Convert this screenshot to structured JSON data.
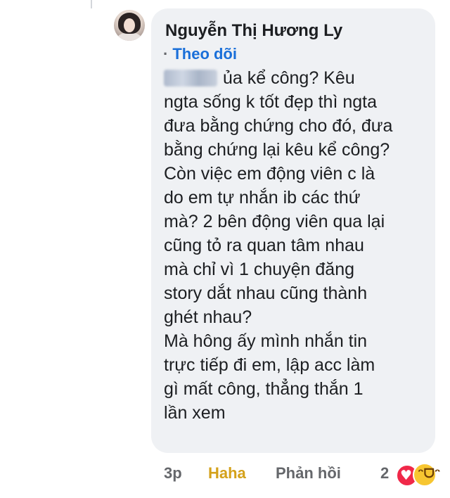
{
  "comment": {
    "author": "Nguyễn Thị Hương Ly",
    "follow_label": "Theo dõi",
    "mention_first_line_rest": "ủa kể công? Kêu",
    "body_lines": [
      "ngta sống k tốt đẹp thì ngta",
      "đưa bằng chứng cho đó, đưa",
      "bằng chứng lại kêu kể công?",
      "Còn việc em động viên c là",
      "do em tự nhắn ib các thứ",
      "mà?  2 bên động viên qua lại",
      "cũng tỏ ra quan tâm nhau",
      "mà chỉ vì 1 chuyện đăng",
      "story dắt nhau cũng thành",
      "ghét nhau?",
      "Mà hông ấy mình nhắn tin",
      "trực tiếp đi em, lập acc làm",
      "gì mất công, thẳng thắn 1",
      "lần xem"
    ]
  },
  "footer": {
    "time": "3p",
    "my_reaction": "Haha",
    "reply_label": "Phản hồi",
    "reaction_count": "2"
  },
  "icons": {
    "avatar": "user-avatar",
    "reactions": [
      "heart-icon",
      "haha-icon"
    ]
  },
  "colors": {
    "bubble_bg": "#eff1f4",
    "link": "#1a6fd9",
    "haha": "#d4a11a",
    "muted": "#65676b",
    "heart": "#f02849"
  }
}
